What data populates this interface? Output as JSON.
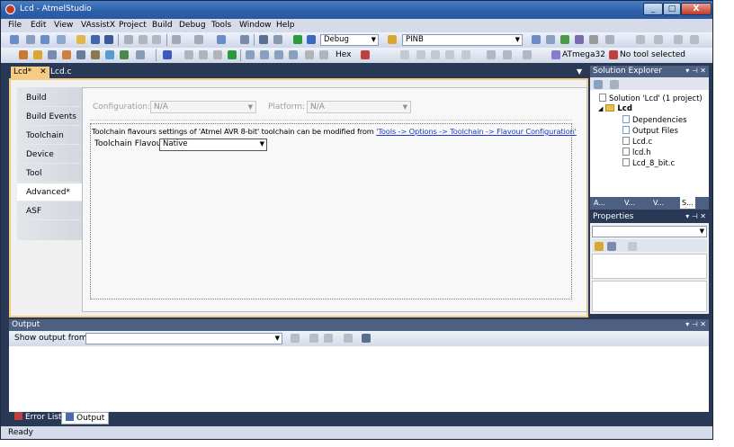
{
  "window": {
    "title": "Lcd - AtmelStudio",
    "min": "_",
    "max": "□",
    "close": "X"
  },
  "menu": [
    "File",
    "Edit",
    "View",
    "VAssistX",
    "Project",
    "Build",
    "Debug",
    "Tools",
    "Window",
    "Help"
  ],
  "toolbar": {
    "config_combo": "Debug",
    "search_combo": "PINB",
    "hex_label": "Hex",
    "device_label": "ATmega32",
    "tool_label": "No tool selected"
  },
  "doc_tabs": [
    {
      "label": "Lcd*",
      "close": "✕"
    },
    {
      "label": "Lcd.c"
    }
  ],
  "project": {
    "side_tabs": [
      "Build",
      "Build Events",
      "Toolchain",
      "Device",
      "Tool",
      "Advanced*",
      "ASF"
    ],
    "selected_tab": "Advanced*",
    "configuration_label": "Configuration:",
    "configuration_value": "N/A",
    "platform_label": "Platform:",
    "platform_value": "N/A",
    "info_text": "Toolchain flavours settings of 'Atmel AVR 8-bit' toolchain can be modified from",
    "info_link": "'Tools -> Options -> Toolchain -> Flavour Configuration'",
    "flavour_label": "Toolchain Flavour",
    "flavour_value": "Native"
  },
  "solution_explorer": {
    "title": "Solution Explorer",
    "controls": "▾ ⊣ ✕",
    "items": {
      "solution": "Solution 'Lcd' (1 project)",
      "project": "Lcd",
      "dependencies": "Dependencies",
      "output_files": "Output Files",
      "file1": "Lcd.c",
      "file2": "lcd.h",
      "file3": "Lcd_8_bit.c"
    },
    "bottom_tabs": [
      "A...",
      "V...",
      "V...",
      "S..."
    ]
  },
  "properties": {
    "title": "Properties",
    "controls": "▾ ⊣ ✕"
  },
  "output": {
    "title": "Output",
    "controls": "▾ ⊣ ✕",
    "show_label": "Show output from:"
  },
  "bottom_tabs": {
    "error_list": "Error List",
    "output": "Output"
  },
  "status": {
    "text": "Ready"
  },
  "colors": {
    "accent": "#293955",
    "doc_border": "#f5cc84",
    "link": "#1a3dc8"
  }
}
